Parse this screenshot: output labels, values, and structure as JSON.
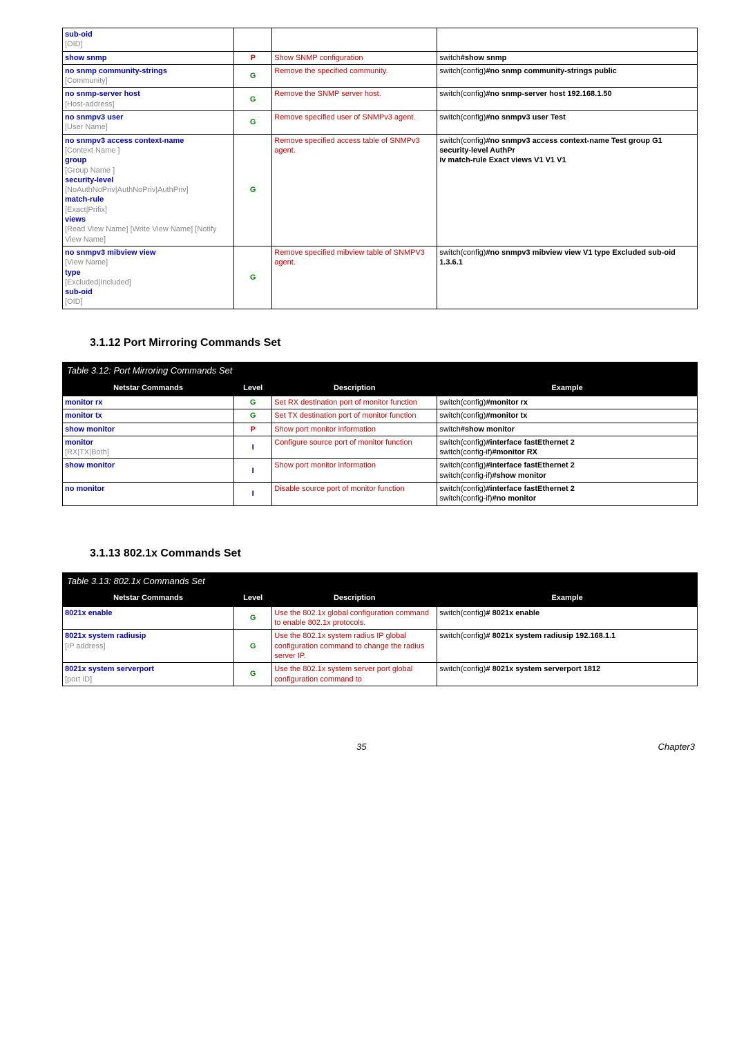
{
  "table1": {
    "rows": [
      {
        "cmd": [
          {
            "t": "sub-oid",
            "c": "blue"
          },
          {
            "t": "[OID]",
            "c": "gray"
          }
        ],
        "lvl": "",
        "lvlClass": "",
        "desc": "",
        "ex": ""
      },
      {
        "cmd": [
          {
            "t": "show snmp",
            "c": "blue"
          }
        ],
        "lvl": "P",
        "lvlClass": "lvl-P",
        "desc": "Show SNMP configuration",
        "ex": [
          {
            "t": "switch",
            "b": false
          },
          {
            "t": "#show snmp",
            "b": true
          }
        ]
      },
      {
        "cmd": [
          {
            "t": "no snmp community-strings",
            "c": "blue"
          },
          {
            "t": "[Community]",
            "c": "gray"
          }
        ],
        "lvl": "G",
        "lvlClass": "lvl-G",
        "desc": "Remove the specified community.",
        "ex": [
          {
            "t": "switch(config)",
            "b": false
          },
          {
            "t": "#no snmp community-strings public",
            "b": true
          }
        ]
      },
      {
        "cmd": [
          {
            "t": "no snmp-server host",
            "c": "blue"
          },
          {
            "t": "[Host-address]",
            "c": "gray"
          }
        ],
        "lvl": "G",
        "lvlClass": "lvl-G",
        "desc": "Remove the SNMP server host.",
        "ex": [
          {
            "t": "switch(config)",
            "b": false
          },
          {
            "t": "#no snmp-server host 192.168.1.50",
            "b": true
          }
        ]
      },
      {
        "cmd": [
          {
            "t": "no snmpv3 user",
            "c": "blue"
          },
          {
            "t": "[User Name]",
            "c": "gray"
          }
        ],
        "lvl": "G",
        "lvlClass": "lvl-G",
        "desc": "Remove specified user of SNMPv3 agent.",
        "ex": [
          {
            "t": "switch(config)",
            "b": false
          },
          {
            "t": "#no snmpv3 user Test",
            "b": true
          }
        ]
      },
      {
        "cmd": [
          {
            "t": "no snmpv3 access context-name",
            "c": "blue"
          },
          {
            "t": "[Context Name ]",
            "c": "gray"
          },
          {
            "t": "group",
            "c": "blue"
          },
          {
            "t": "[Group Name ]",
            "c": "gray"
          },
          {
            "t": "security-level",
            "c": "blue"
          },
          {
            "t": "[NoAuthNoPriv|AuthNoPriv|AuthPriv]",
            "c": "gray"
          },
          {
            "t": "match-rule",
            "c": "blue"
          },
          {
            "t": "[Exact|Prifix]",
            "c": "gray"
          },
          {
            "t": "views",
            "c": "blue"
          },
          {
            "t": "[Read View Name] [Write View Name] [Notify View Name]",
            "c": "gray"
          }
        ],
        "lvl": "G",
        "lvlClass": "lvl-G",
        "desc": "Remove specified access table of SNMPv3 agent.",
        "ex": [
          {
            "t": "switch(config)",
            "b": false
          },
          {
            "t": "#no snmpv3 access context-name Test group G1 security-level AuthPr",
            "b": true
          },
          {
            "br": true
          },
          {
            "t": "iv match-rule Exact views V1 V1 V1",
            "b": true
          }
        ]
      },
      {
        "cmd": [
          {
            "t": "no snmpv3 mibview view",
            "c": "blue"
          },
          {
            "t": "[View Name]",
            "c": "gray"
          },
          {
            "t": "type",
            "c": "blue"
          },
          {
            "t": "[Excluded|Included]",
            "c": "gray"
          },
          {
            "t": "sub-oid",
            "c": "blue"
          },
          {
            "t": "[OID]",
            "c": "gray"
          }
        ],
        "lvl": "G",
        "lvlClass": "lvl-G",
        "desc": "Remove specified mibview table of SNMPV3 agent.",
        "ex": [
          {
            "t": "switch(config)",
            "b": false
          },
          {
            "t": "#no snmpv3 mibview view V1 type Excluded sub-oid 1.3.6.1",
            "b": true
          }
        ]
      }
    ]
  },
  "section12": {
    "heading": "3.1.12    Port Mirroring Commands Set",
    "caption": "Table 3.12: Port Mirroring Commands Set",
    "headers": {
      "cmd": "Netstar Commands",
      "lvl": "Level",
      "desc": "Description",
      "ex": "Example"
    },
    "rows": [
      {
        "cmd": [
          {
            "t": "monitor rx",
            "c": "blue"
          }
        ],
        "lvl": "G",
        "lvlClass": "lvl-G",
        "desc": "Set RX destination port of monitor function",
        "ex": [
          {
            "t": "switch(config)",
            "b": false
          },
          {
            "t": "#monitor rx",
            "b": true
          }
        ]
      },
      {
        "cmd": [
          {
            "t": "monitor tx",
            "c": "blue"
          }
        ],
        "lvl": "G",
        "lvlClass": "lvl-G",
        "desc": "Set TX destination port of monitor function",
        "ex": [
          {
            "t": "switch(config)",
            "b": false
          },
          {
            "t": "#monitor tx",
            "b": true
          }
        ]
      },
      {
        "cmd": [
          {
            "t": "show monitor",
            "c": "blue"
          }
        ],
        "lvl": "P",
        "lvlClass": "lvl-P",
        "desc": "Show port monitor information",
        "ex": [
          {
            "t": "switch",
            "b": false
          },
          {
            "t": "#show monitor",
            "b": true
          }
        ]
      },
      {
        "cmd": [
          {
            "t": "monitor",
            "c": "blue"
          },
          {
            "t": "[RX|TX|Both]",
            "c": "gray"
          }
        ],
        "lvl": "I",
        "lvlClass": "lvl-I",
        "desc": "Configure source port of monitor function",
        "ex": [
          {
            "t": "switch(config)",
            "b": false
          },
          {
            "t": "#interface fastEthernet 2",
            "b": true
          },
          {
            "br": true
          },
          {
            "t": "switch(config-if)",
            "b": false
          },
          {
            "t": "#monitor RX",
            "b": true
          }
        ]
      },
      {
        "cmd": [
          {
            "t": "show monitor",
            "c": "blue"
          }
        ],
        "lvl": "I",
        "lvlClass": "lvl-I",
        "desc": "Show port monitor information",
        "ex": [
          {
            "t": "switch(config)",
            "b": false
          },
          {
            "t": "#interface fastEthernet 2",
            "b": true
          },
          {
            "br": true
          },
          {
            "t": "switch(config-if)",
            "b": false
          },
          {
            "t": "#show monitor",
            "b": true
          }
        ]
      },
      {
        "cmd": [
          {
            "t": "no monitor",
            "c": "blue"
          }
        ],
        "lvl": "I",
        "lvlClass": "lvl-I",
        "desc": "Disable source port of monitor function",
        "ex": [
          {
            "t": "switch(config)",
            "b": false
          },
          {
            "t": "#interface fastEthernet 2",
            "b": true
          },
          {
            "br": true
          },
          {
            "t": "switch(config-if)",
            "b": false
          },
          {
            "t": "#no monitor",
            "b": true
          }
        ]
      }
    ]
  },
  "section13": {
    "heading": "3.1.13    802.1x Commands Set",
    "caption": "Table 3.13: 802.1x  Commands Set",
    "headers": {
      "cmd": "Netstar Commands",
      "lvl": "Level",
      "desc": "Description",
      "ex": "Example"
    },
    "rows": [
      {
        "cmd": [
          {
            "t": "8021x enable",
            "c": "blue"
          }
        ],
        "lvl": "G",
        "lvlClass": "lvl-G",
        "desc": "Use the 802.1x global configuration command to enable 802.1x protocols.",
        "ex": [
          {
            "t": "switch(config)",
            "b": false
          },
          {
            "t": "# 8021x enable",
            "b": true
          }
        ]
      },
      {
        "cmd": [
          {
            "t": "8021x system radiusip",
            "c": "blue"
          },
          {
            "t": "[IP address]",
            "c": "gray"
          }
        ],
        "lvl": "G",
        "lvlClass": "lvl-G",
        "desc": "Use the 802.1x system radius IP global configuration command to change the radius server IP.",
        "ex": [
          {
            "t": "switch(config)",
            "b": false
          },
          {
            "t": "# 8021x system radiusip 192.168.1.1",
            "b": true
          }
        ]
      },
      {
        "cmd": [
          {
            "t": "8021x system serverport",
            "c": "blue"
          },
          {
            "t": "[port ID]",
            "c": "gray"
          }
        ],
        "lvl": "G",
        "lvlClass": "lvl-G",
        "desc": "Use the 802.1x system server port global configuration command to",
        "ex": [
          {
            "t": "switch(config)",
            "b": false
          },
          {
            "t": "# 8021x system serverport  1812",
            "b": true
          }
        ]
      }
    ]
  },
  "footer": {
    "page": "35",
    "chapter": "Chapter3"
  }
}
